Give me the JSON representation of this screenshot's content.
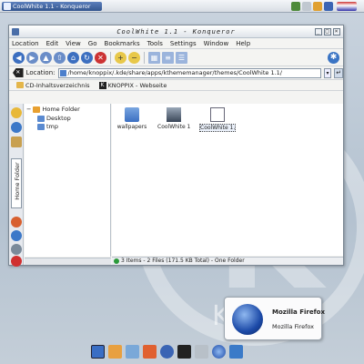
{
  "panel": {
    "task_label": "CoolWhite 1.1 - Konqueror"
  },
  "window": {
    "title": "CoolWhite 1.1 - Konqueror",
    "menu": [
      "Location",
      "Edit",
      "View",
      "Go",
      "Bookmarks",
      "Tools",
      "Settings",
      "Window",
      "Help"
    ],
    "location_label": "Location:",
    "location_value": "/home/knoppix/.kde/share/apps/kthememanager/themes/CoolWhite 1.1/",
    "bookmarks": [
      "CD-Inhaltsverzeichnis",
      "KNOPPIX - Webseite"
    ],
    "sidebar_tab_label": "Home Folder",
    "tree": {
      "root": "Home Folder",
      "children": [
        "Desktop",
        "tmp"
      ]
    },
    "files": [
      {
        "name": "wallpapers",
        "icon": "folder-icon"
      },
      {
        "name": "CoolWhite 1....",
        "icon": "image-file-icon"
      },
      {
        "name": "CoolWhite 1....",
        "icon": "theme-file-icon"
      }
    ],
    "status": "3 Items - 2 Files (171.5 KB Total) - One Folder"
  },
  "notification": {
    "title": "Mozilla Firefox",
    "body": "Mozilla Firefox"
  },
  "colors": {
    "titlebar_accent": "#4a6ea8",
    "selection": "#eaf0fa"
  }
}
